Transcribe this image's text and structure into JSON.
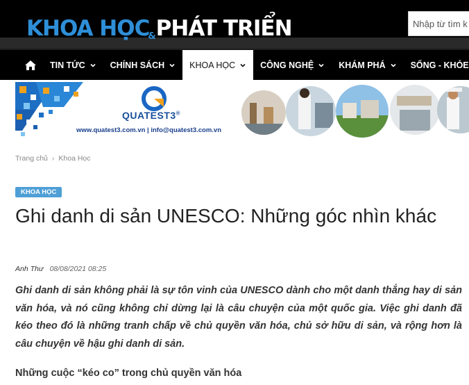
{
  "header": {
    "logo_part1": "KHOA HỌC",
    "logo_amp": "&",
    "logo_part2": "PHÁT TRIỂN",
    "search_placeholder": "Nhập từ tìm k"
  },
  "nav": {
    "items": [
      {
        "label": "TIN TỨC",
        "has_dropdown": true
      },
      {
        "label": "CHÍNH SÁCH",
        "has_dropdown": true
      },
      {
        "label": "KHOA HỌC",
        "has_dropdown": true,
        "active": true
      },
      {
        "label": "CÔNG NGHỆ",
        "has_dropdown": true
      },
      {
        "label": "KHÁM PHÁ",
        "has_dropdown": true
      },
      {
        "label": "SỐNG - KHỎE",
        "has_dropdown": false
      }
    ]
  },
  "banner": {
    "brand_name": "QUATEST3",
    "brand_mark": "®",
    "contact": "www.quatest3.com.vn | info@quatest3.com.vn"
  },
  "breadcrumb": {
    "home": "Trang chủ",
    "separator": "›",
    "current": "Khoa Học"
  },
  "article": {
    "category": "KHOA HỌC",
    "title": "Ghi danh di sản UNESCO: Những góc nhìn khác",
    "author": "Anh Thư",
    "date": "08/08/2021 08:25",
    "lead": "Ghi danh di sản không phải là sự tôn vinh của UNESCO dành cho một danh thắng hay di sản văn hóa, và nó cũng không chỉ dừng lại là câu chuyện của một quốc gia. Việc ghi danh đã kéo theo đó là những tranh chấp về chủ quyền văn hóa, chủ sở hữu di sản, và rộng hơn là câu chuyện về hậu ghi danh di sản.",
    "subheading": "Những cuộc “kéo co” trong chủ quyền văn hóa"
  },
  "colors": {
    "header_bg": "#000000",
    "logo_blue": "#2e8fd8",
    "badge_blue": "#4e9fd6",
    "brand_blue": "#1a4f9c"
  },
  "icons": {
    "home": "home-icon",
    "dropdown": "chevron-down-icon"
  }
}
